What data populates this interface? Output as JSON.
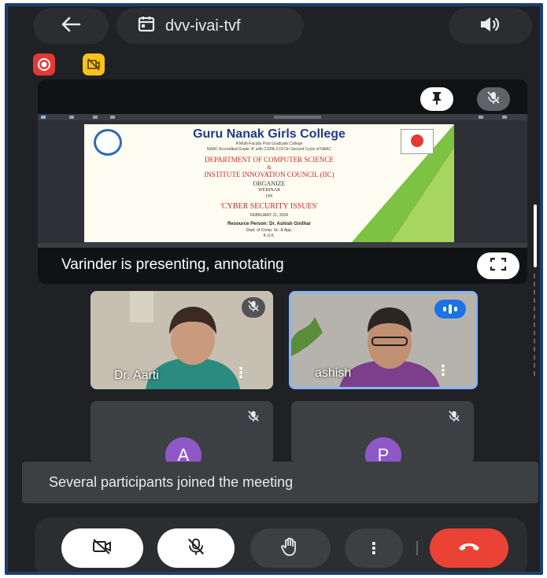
{
  "meeting": {
    "code": "dvv-ivai-tvf"
  },
  "icons": {
    "back": "arrow-left-icon",
    "calendar": "calendar-icon",
    "audio": "speaker-icon",
    "record": "recording-icon",
    "camera_off_badge": "camera-off-icon",
    "pin": "pin-icon",
    "mic_off": "mic-off-icon",
    "fullscreen": "fullscreen-icon",
    "hand": "raise-hand-icon",
    "more": "more-vert-icon",
    "end_call": "end-call-icon",
    "speaking": "speaking-indicator-icon"
  },
  "presentation": {
    "presenting_label": "Varinder is presenting, annotating",
    "slide": {
      "college": "Guru Nanak Girls College",
      "sub1": "A Multi-Faculty Post Graduate College",
      "sub2": "NAAC Accredited Grade 'A' with CGPA 3.18 On Second Cycle of NAAC",
      "dept": "DEPARTMENT OF COMPUTER SCIENCE",
      "amp": "&",
      "iic": "INSTITUTE INNOVATION COUNCIL (IIC)",
      "organize": "ORGANIZE",
      "webinar": "WEBINAR",
      "on": "ON",
      "topic": "'CYBER SECURITY ISSUES'",
      "date": "FEBRUARY 21, 2024",
      "resource_label": "Resource Person: Dr. Ashish Girdhar",
      "resource_line2": "Dept. of Comp. Sc. & App.",
      "resource_line3": "K.U.K."
    }
  },
  "participants": [
    {
      "name": "Dr. Aarti",
      "muted": true,
      "speaking": false
    },
    {
      "name": "ashish",
      "muted": false,
      "speaking": true
    },
    {
      "initial": "A",
      "muted": true
    },
    {
      "initial": "P",
      "muted": true
    }
  ],
  "toast": {
    "message": "Several participants joined the meeting"
  },
  "colors": {
    "background": "#202124",
    "end_call": "#ea4335",
    "avatar": "#8e58c9",
    "record": "#e53935",
    "camera_badge": "#f7c21a",
    "active_border": "#8ab4f8"
  }
}
